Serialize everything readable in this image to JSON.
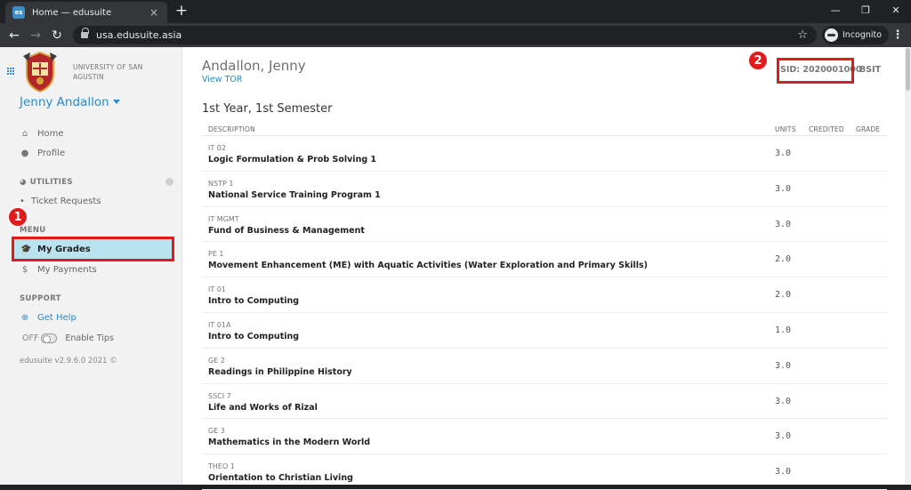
{
  "browser": {
    "tab_title": "Home — edusuite",
    "favicon_text": "es",
    "tab_close": "×",
    "new_tab": "+",
    "url": "usa.edusuite.asia",
    "incognito_label": "Incognito",
    "window_controls": [
      "—",
      "❐",
      "✕"
    ]
  },
  "sidebar": {
    "university": "UNIVERSITY OF SAN AGUSTIN",
    "user_name": "Jenny Andallon",
    "items": [
      {
        "label": "Home",
        "icon": "home-icon",
        "glyph": "⌂"
      },
      {
        "label": "Profile",
        "icon": "user-icon",
        "glyph": "●"
      }
    ],
    "utilities_heading": "UTILITIES",
    "utilities_icon": "gauge-icon",
    "ticket_requests": "Ticket Requests",
    "menu_heading": "MENU",
    "my_grades": "My Grades",
    "my_grades_icon": "graduation-cap-icon",
    "my_payments": "My Payments",
    "my_payments_icon": "dollar-icon",
    "support_heading": "SUPPORT",
    "get_help": "Get Help",
    "get_help_icon": "lifebuoy-icon",
    "tips_state": "OFF",
    "enable_tips": "Enable Tips",
    "version": "edusuite v2.9.6.0 2021 ©"
  },
  "annotations": {
    "badge_1": "1",
    "badge_2": "2",
    "color": "#e01b1b"
  },
  "student": {
    "name": "Andallon, Jenny",
    "view_tor": "View TOR",
    "sid": "SID: 2020001000",
    "program": "BSIT"
  },
  "semester": {
    "title": "1st Year, 1st Semester",
    "columns": [
      "DESCRIPTION",
      "UNITS",
      "CREDITED",
      "GRADE"
    ],
    "courses": [
      {
        "code": "IT 02",
        "description": "Logic Formulation & Prob Solving 1",
        "units": "3.0"
      },
      {
        "code": "NSTP 1",
        "description": "National Service Training Program 1",
        "units": "3.0"
      },
      {
        "code": "IT MGMT",
        "description": "Fund of Business & Management",
        "units": "3.0"
      },
      {
        "code": "PE 1",
        "description": "Movement Enhancement (ME) with Aquatic Activities (Water Exploration and Primary Skills)",
        "units": "2.0"
      },
      {
        "code": "IT 01",
        "description": "Intro to Computing",
        "units": "2.0"
      },
      {
        "code": "IT 01A",
        "description": "Intro to Computing",
        "units": "1.0"
      },
      {
        "code": "GE 2",
        "description": "Readings in Philippine History",
        "units": "3.0"
      },
      {
        "code": "SSCI 7",
        "description": "Life and Works of Rizal",
        "units": "3.0"
      },
      {
        "code": "GE 3",
        "description": "Mathematics in the Modern World",
        "units": "3.0"
      },
      {
        "code": "THEO 1",
        "description": "Orientation to Christian Living",
        "units": "3.0"
      }
    ]
  }
}
